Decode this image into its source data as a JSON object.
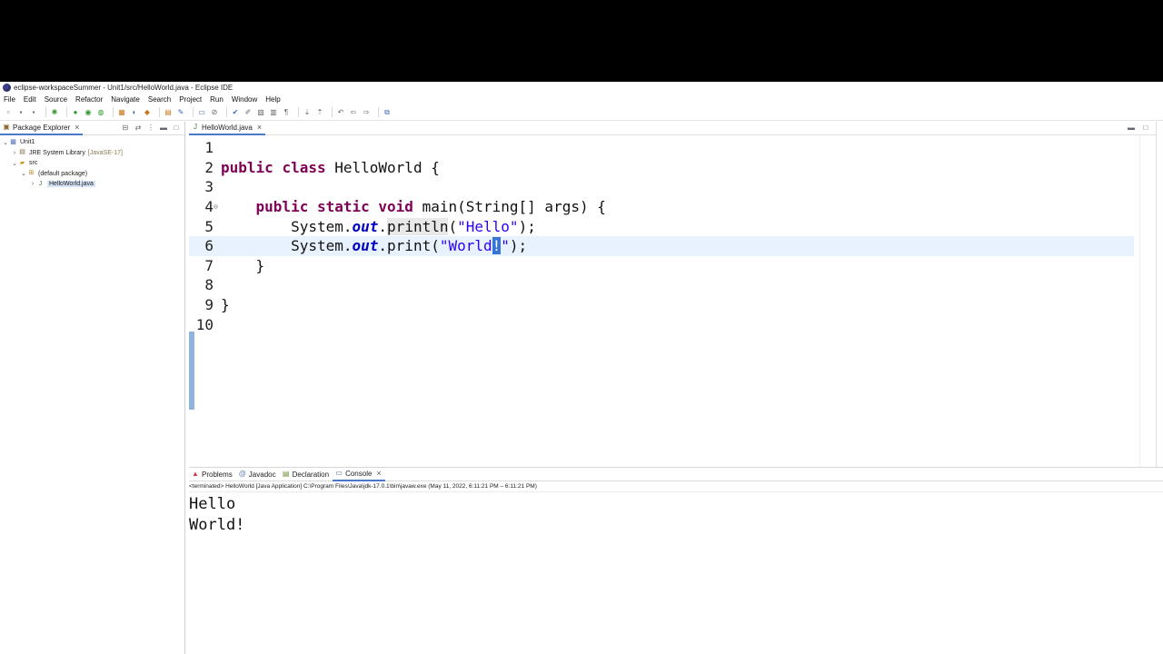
{
  "window": {
    "title": "eclipse-workspaceSummer - Unit1/src/HelloWorld.java - Eclipse IDE"
  },
  "menubar": [
    "File",
    "Edit",
    "Source",
    "Refactor",
    "Navigate",
    "Search",
    "Project",
    "Run",
    "Window",
    "Help"
  ],
  "package_explorer": {
    "tab_label": "Package Explorer",
    "tree": [
      {
        "label": "Unit1",
        "extra": "",
        "depth": 0,
        "expanded": true,
        "icon": "project-icon"
      },
      {
        "label": "JRE System Library",
        "extra": "[JavaSE-17]",
        "depth": 1,
        "expanded": false,
        "icon": "library-icon"
      },
      {
        "label": "src",
        "extra": "",
        "depth": 1,
        "expanded": true,
        "icon": "source-folder-icon"
      },
      {
        "label": "(default package)",
        "extra": "",
        "depth": 2,
        "expanded": true,
        "icon": "package-icon"
      },
      {
        "label": "HelloWorld.java",
        "extra": "",
        "depth": 3,
        "expanded": false,
        "icon": "java-file-icon",
        "selected": true
      }
    ]
  },
  "editor": {
    "tab_label": "HelloWorld.java",
    "line_numbers": [
      "1",
      "2",
      "3",
      "4",
      "5",
      "6",
      "7",
      "8",
      "9",
      "10"
    ],
    "fold_marker_line": "4",
    "current_line": "6"
  },
  "bottom_panel": {
    "tabs": [
      {
        "label": "Problems",
        "icon": "problems-icon"
      },
      {
        "label": "Javadoc",
        "icon": "javadoc-icon"
      },
      {
        "label": "Declaration",
        "icon": "declaration-icon"
      },
      {
        "label": "Console",
        "icon": "console-icon",
        "active": true
      }
    ],
    "console_status": "<terminated> HelloWorld [Java Application] C:\\Program Files\\Java\\jdk-17.0.1\\bin\\javaw.exe (May 11, 2022, 6:11:21 PM – 6:11:21 PM)",
    "output_lines": [
      "Hello",
      "World!"
    ]
  },
  "colors": {
    "keyword": "#7f0055",
    "string": "#2a00ff",
    "static_field": "#0000c0",
    "current_line_bg": "#e8f2fe",
    "selection": "#3874d8"
  }
}
